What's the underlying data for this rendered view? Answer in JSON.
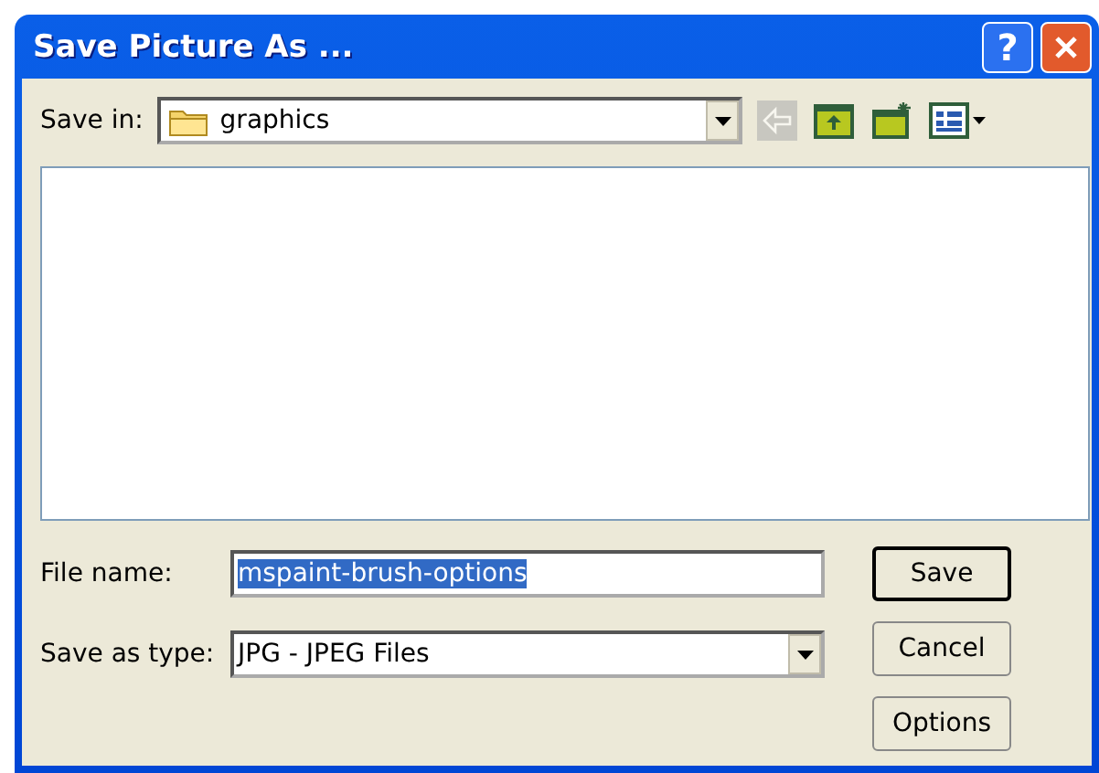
{
  "window": {
    "title": "Save Picture As ..."
  },
  "title_buttons": [
    {
      "kind": "help",
      "label": "?"
    },
    {
      "kind": "close"
    }
  ],
  "save_in": {
    "label": "Save in:",
    "value": "graphics"
  },
  "toolbar": [
    {
      "kind": "back",
      "disabled": true
    },
    {
      "kind": "up",
      "disabled": false
    },
    {
      "kind": "new_folder",
      "disabled": false
    },
    {
      "kind": "view",
      "disabled": false
    }
  ],
  "file_name": {
    "label": "File name:",
    "value": "mspaint-brush-options",
    "selected": true
  },
  "save_as_type": {
    "label": "Save as type:",
    "value": "JPG - JPEG Files"
  },
  "buttons": [
    {
      "label": "Save",
      "default": true
    },
    {
      "label": "Cancel",
      "default": false
    },
    {
      "label": "Options",
      "default": false
    }
  ]
}
